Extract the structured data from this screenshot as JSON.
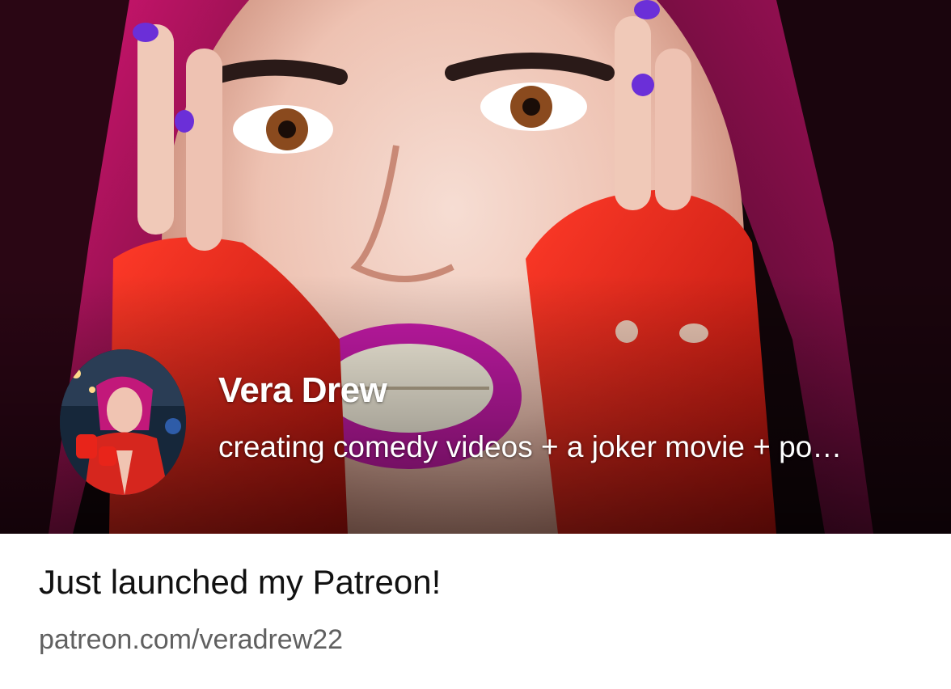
{
  "link_card": {
    "creator_name": "Vera Drew",
    "creator_tagline": "creating comedy videos + a joker movie + po…",
    "title": "Just launched my Patreon!",
    "domain": "patreon.com/veradrew22"
  },
  "media": {
    "cover_image": "portrait-photo-red-gloves",
    "avatar_image": "profile-photo"
  },
  "colors": {
    "text_primary": "#111111",
    "text_secondary": "#606060",
    "overlay_text": "#ffffff"
  }
}
